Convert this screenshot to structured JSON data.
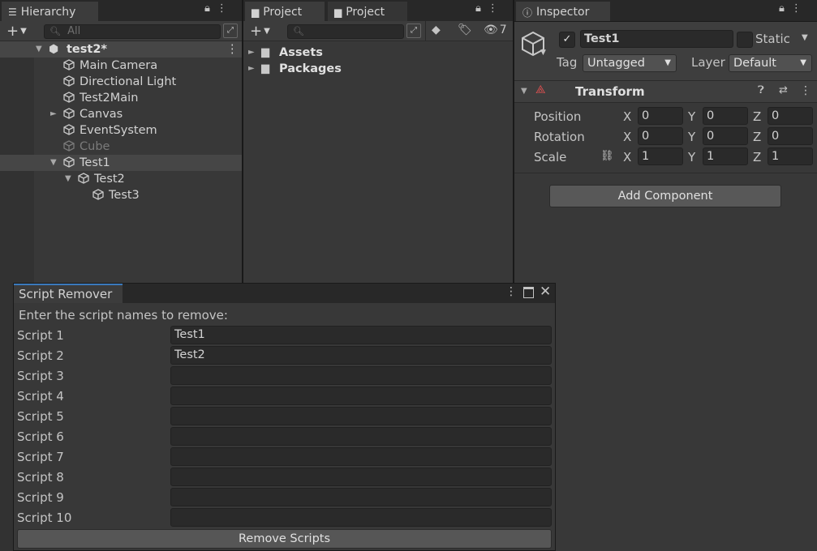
{
  "hierarchy": {
    "tab_label": "Hierarchy",
    "search_placeholder": "All",
    "scene_name": "test2*",
    "items": [
      {
        "label": "Main Camera"
      },
      {
        "label": "Directional Light"
      },
      {
        "label": "Test2Main"
      },
      {
        "label": "Canvas"
      },
      {
        "label": "EventSystem"
      },
      {
        "label": "Cube"
      },
      {
        "label": "Test1"
      },
      {
        "label": "Test2"
      },
      {
        "label": "Test3"
      }
    ]
  },
  "project": {
    "tab1_label": "Project",
    "tab2_label": "Project",
    "hidden_count": "7",
    "folders": [
      {
        "label": "Assets"
      },
      {
        "label": "Packages"
      }
    ]
  },
  "inspector": {
    "tab_label": "Inspector",
    "object_name": "Test1",
    "static_label": "Static",
    "tag_label": "Tag",
    "tag_value": "Untagged",
    "layer_label": "Layer",
    "layer_value": "Default",
    "transform_label": "Transform",
    "position_label": "Position",
    "rotation_label": "Rotation",
    "scale_label": "Scale",
    "axis_x": "X",
    "axis_y": "Y",
    "axis_z": "Z",
    "position": {
      "x": "0",
      "y": "0",
      "z": "0"
    },
    "rotation": {
      "x": "0",
      "y": "0",
      "z": "0"
    },
    "scale": {
      "x": "1",
      "y": "1",
      "z": "1"
    },
    "add_component_label": "Add Component"
  },
  "script_remover": {
    "title": "Script Remover",
    "instruction": "Enter the script names to remove:",
    "scripts": [
      {
        "label": "Script 1",
        "value": "Test1"
      },
      {
        "label": "Script 2",
        "value": "Test2"
      },
      {
        "label": "Script 3",
        "value": ""
      },
      {
        "label": "Script 4",
        "value": ""
      },
      {
        "label": "Script 5",
        "value": ""
      },
      {
        "label": "Script 6",
        "value": ""
      },
      {
        "label": "Script 7",
        "value": ""
      },
      {
        "label": "Script 8",
        "value": ""
      },
      {
        "label": "Script 9",
        "value": ""
      },
      {
        "label": "Script 10",
        "value": ""
      }
    ],
    "remove_button_label": "Remove Scripts"
  }
}
